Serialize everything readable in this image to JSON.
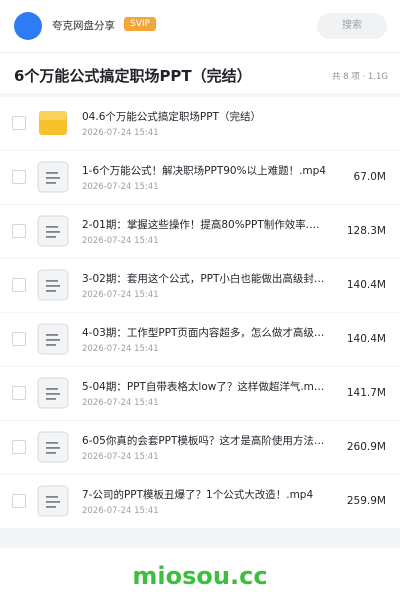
{
  "header": {
    "app_name": "夸克网盘分享",
    "badge": "SVIP",
    "search_label": "搜索"
  },
  "folder": {
    "title": "6个万能公式搞定职场PPT（完结）",
    "meta": "共 8 项 · 1.1G"
  },
  "files": [
    {
      "name": "04.6个万能公式搞定职场PPT（完结）",
      "date": "2026-07-24 15:41",
      "size": "",
      "type": "folder"
    },
    {
      "name": "1-6个万能公式！解决职场PPT90%以上难题！.mp4",
      "date": "2026-07-24 15:41",
      "size": "67.0M",
      "type": "video"
    },
    {
      "name": "2-01期：掌握这些操作！提高80%PPT制作效率.mp4",
      "date": "2026-07-24 15:41",
      "size": "128.3M",
      "type": "video"
    },
    {
      "name": "3-02期：套用这个公式，PPT小白也能做出高级封面.mp4",
      "date": "2026-07-24 15:41",
      "size": "140.4M",
      "type": "video"
    },
    {
      "name": "4-03期：工作型PPT页面内容超多，怎么做才高级.mp4",
      "date": "2026-07-24 15:41",
      "size": "140.4M",
      "type": "video"
    },
    {
      "name": "5-04期：PPT自带表格太low了？这样做超洋气.mp4",
      "date": "2026-07-24 15:41",
      "size": "141.7M",
      "type": "video"
    },
    {
      "name": "6-05你真的会套PPT模板吗？这才是高阶使用方法.mp4",
      "date": "2026-07-24 15:41",
      "size": "260.9M",
      "type": "video"
    },
    {
      "name": "7-公司的PPT模板丑爆了？1个公式大改造！.mp4",
      "date": "2026-07-24 15:41",
      "size": "259.9M",
      "type": "video"
    }
  ],
  "watermark": "miosou.cc",
  "colors": {
    "accent": "#2f7bf5",
    "badge": "#f2a63a",
    "folder": "#f7c12b",
    "watermark": "#3cbf3f"
  }
}
